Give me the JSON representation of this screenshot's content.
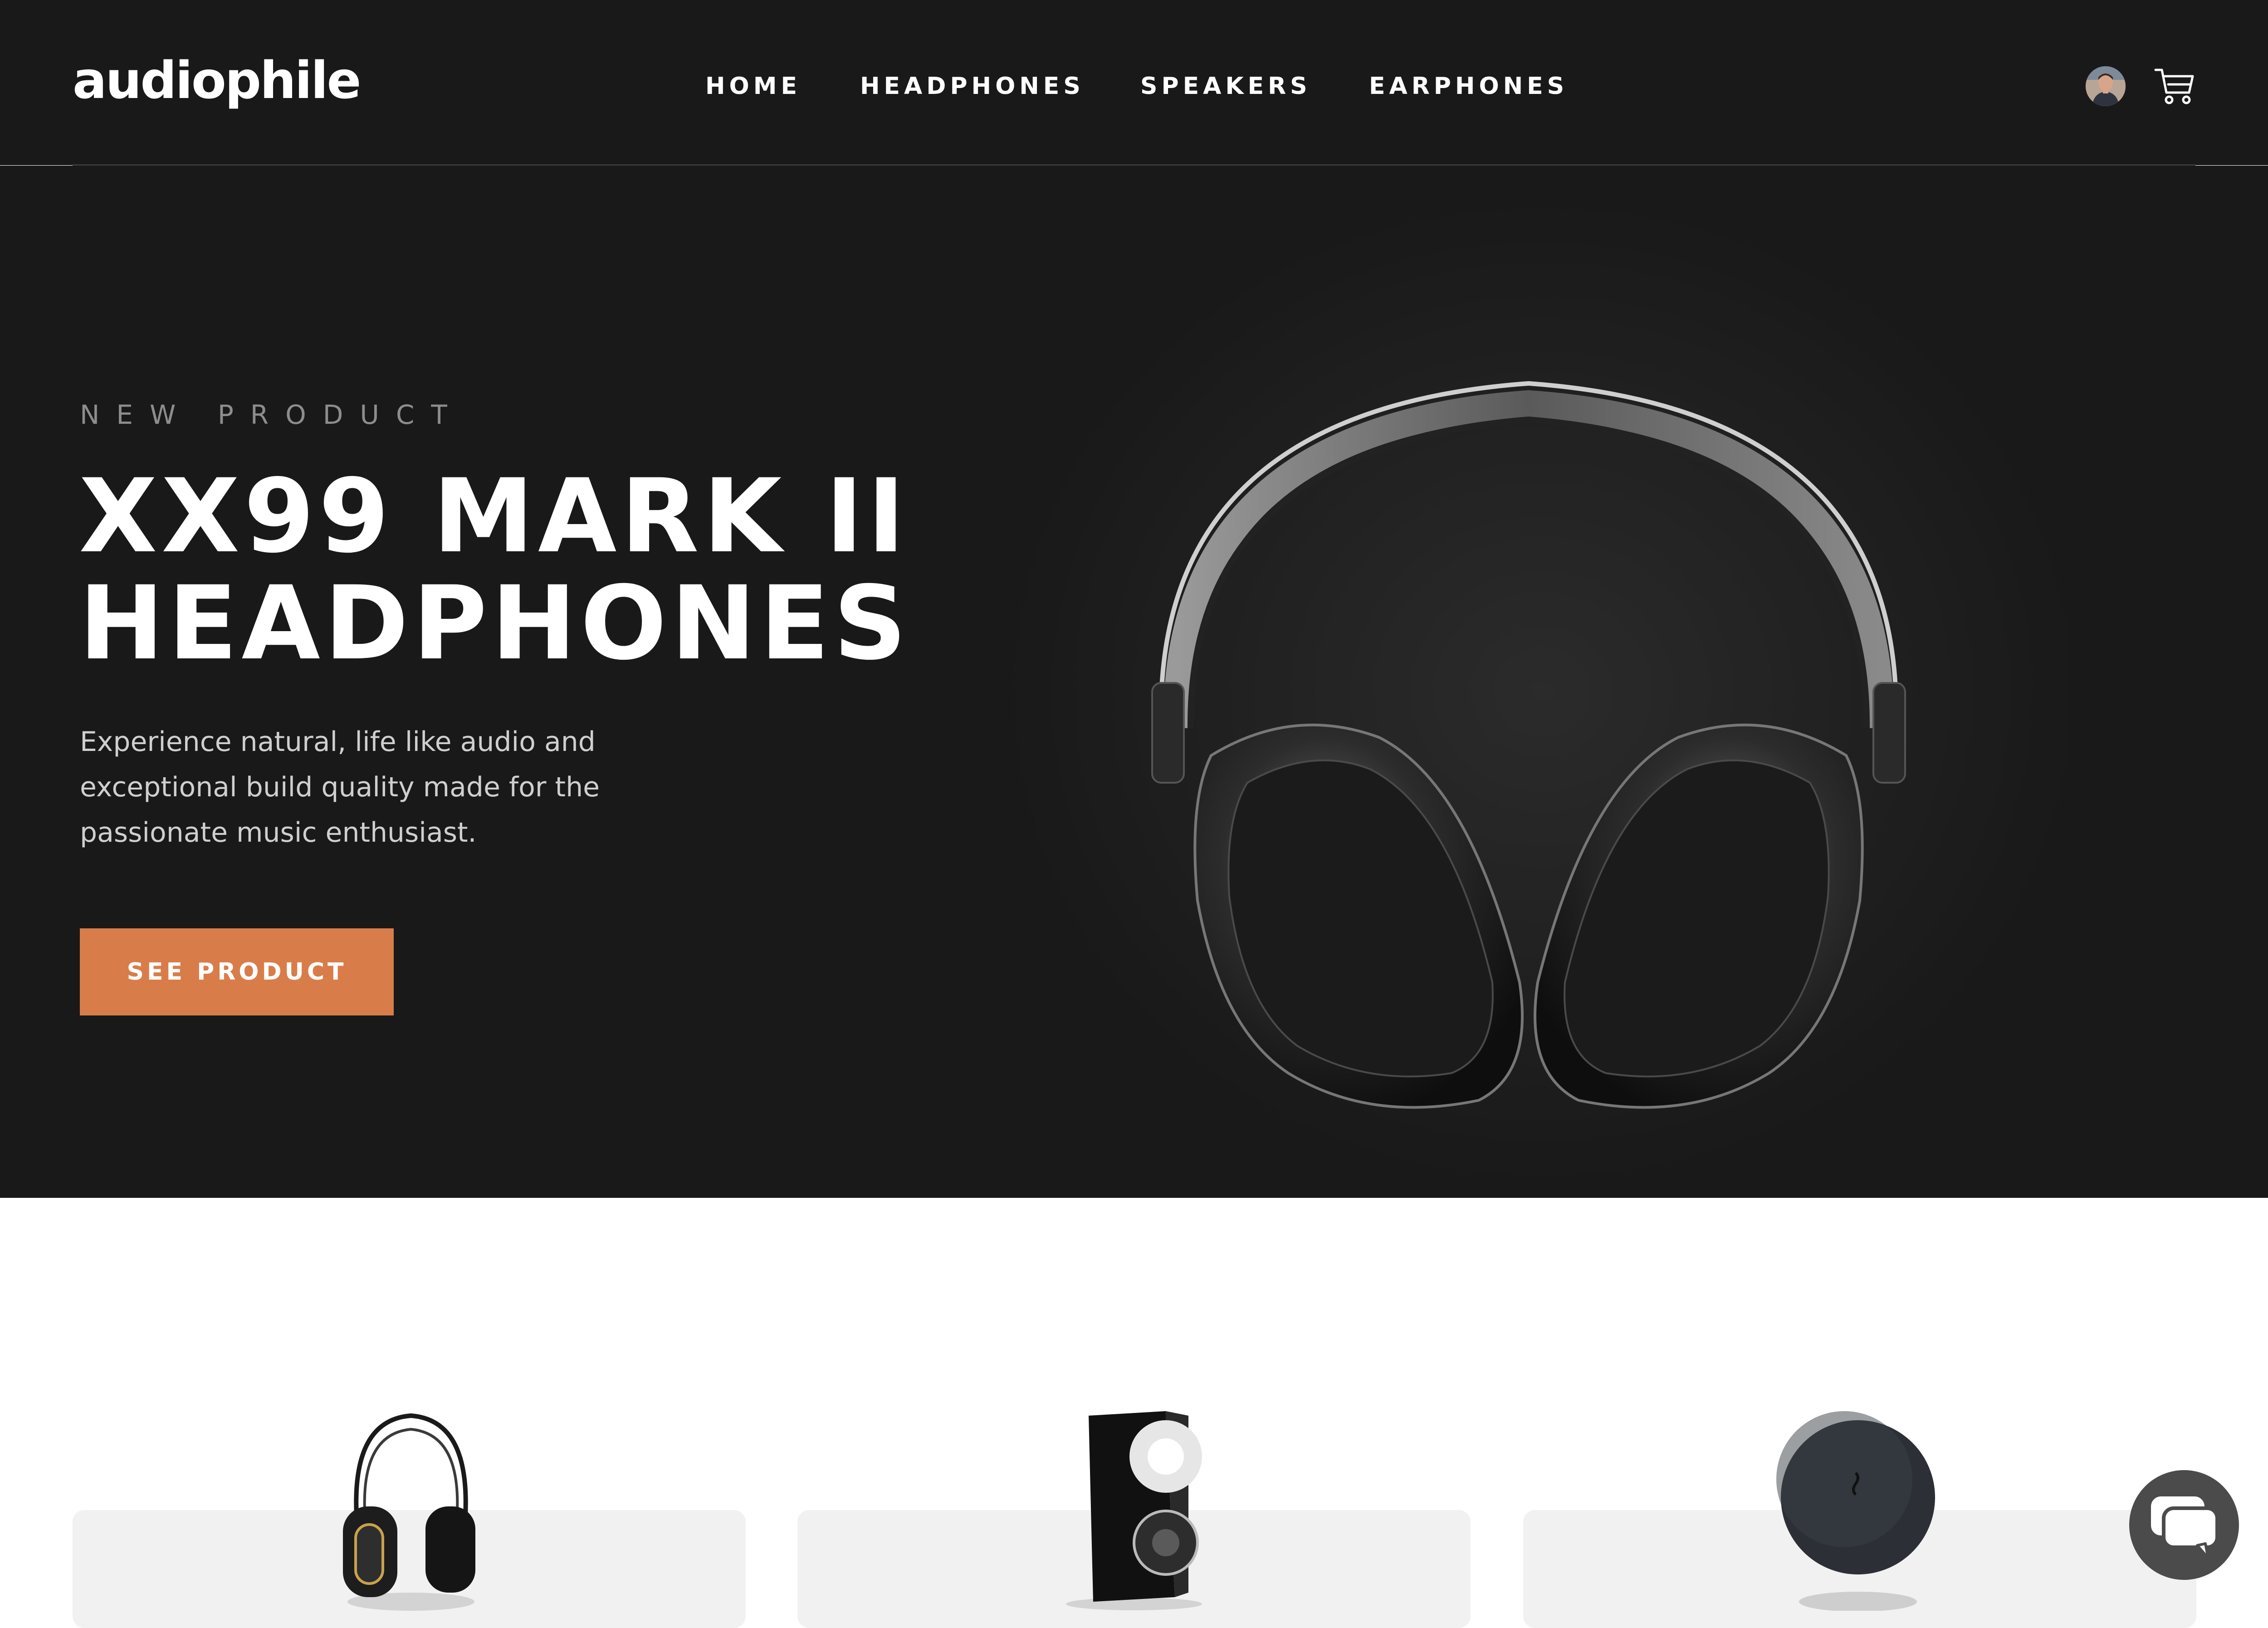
{
  "brand": {
    "logo_text": "audiophile",
    "accent_color": "#d87d4a"
  },
  "nav": {
    "items": [
      "HOME",
      "HEADPHONES",
      "SPEAKERS",
      "EARPHONES"
    ]
  },
  "header_icons": {
    "avatar": "user-avatar",
    "cart": "cart-icon"
  },
  "hero": {
    "overline": "NEW PRODUCT",
    "title_lines": [
      "XX99 MARK II",
      "HEADPHONES"
    ],
    "description_lines": [
      "Experience natural, life like audio and",
      "exceptional build quality made for the",
      "passionate music enthusiast."
    ],
    "cta_label": "SEE PRODUCT",
    "image": "headphones-hero-image"
  },
  "categories": [
    {
      "image": "headphones-thumbnail"
    },
    {
      "image": "speaker-thumbnail"
    },
    {
      "image": "earphones-case-thumbnail"
    }
  ],
  "chat_widget": {
    "icon": "chat-icon"
  }
}
